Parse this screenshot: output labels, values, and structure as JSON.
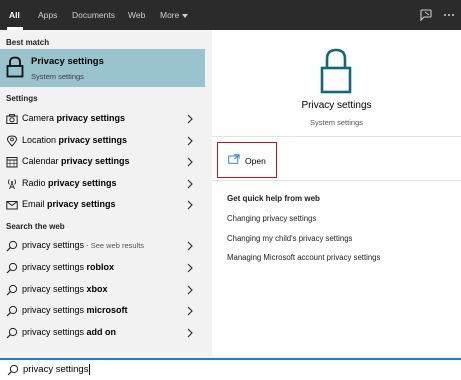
{
  "tabs": [
    "All",
    "Apps",
    "Documents",
    "Web",
    "More"
  ],
  "sections": {
    "best_match": "Best match",
    "settings": "Settings",
    "search_web": "Search the web"
  },
  "best_match": {
    "title": "Privacy settings",
    "subtitle": "System settings"
  },
  "settings_items": [
    {
      "prefix": "Camera ",
      "bold": "privacy settings",
      "icon": "camera-icon"
    },
    {
      "prefix": "Location ",
      "bold": "privacy settings",
      "icon": "location-icon"
    },
    {
      "prefix": "Calendar ",
      "bold": "privacy settings",
      "icon": "calendar-icon"
    },
    {
      "prefix": "Radio ",
      "bold": "privacy settings",
      "icon": "radio-icon"
    },
    {
      "prefix": "Email ",
      "bold": "privacy settings",
      "icon": "email-icon"
    }
  ],
  "web_items": [
    {
      "prefix": "privacy settings",
      "bold": "",
      "hint": " - See web results"
    },
    {
      "prefix": "privacy settings ",
      "bold": "roblox",
      "hint": ""
    },
    {
      "prefix": "privacy settings ",
      "bold": "xbox",
      "hint": ""
    },
    {
      "prefix": "privacy settings ",
      "bold": "microsoft",
      "hint": ""
    },
    {
      "prefix": "privacy settings ",
      "bold": "add on",
      "hint": ""
    }
  ],
  "preview": {
    "title": "Privacy settings",
    "subtitle": "System settings",
    "open_label": "Open",
    "help_title": "Get quick help from web",
    "help_links": [
      "Changing privacy settings",
      "Changing my child's privacy settings",
      "Managing Microsoft account privacy settings"
    ]
  },
  "search": {
    "query": "privacy settings"
  },
  "colors": {
    "topbar": "#2b2b2b",
    "selection": "#9ac4cd",
    "accent_blue": "#1e7fd1",
    "lock_teal": "#0c6b76",
    "highlight_red": "#c0141c"
  }
}
